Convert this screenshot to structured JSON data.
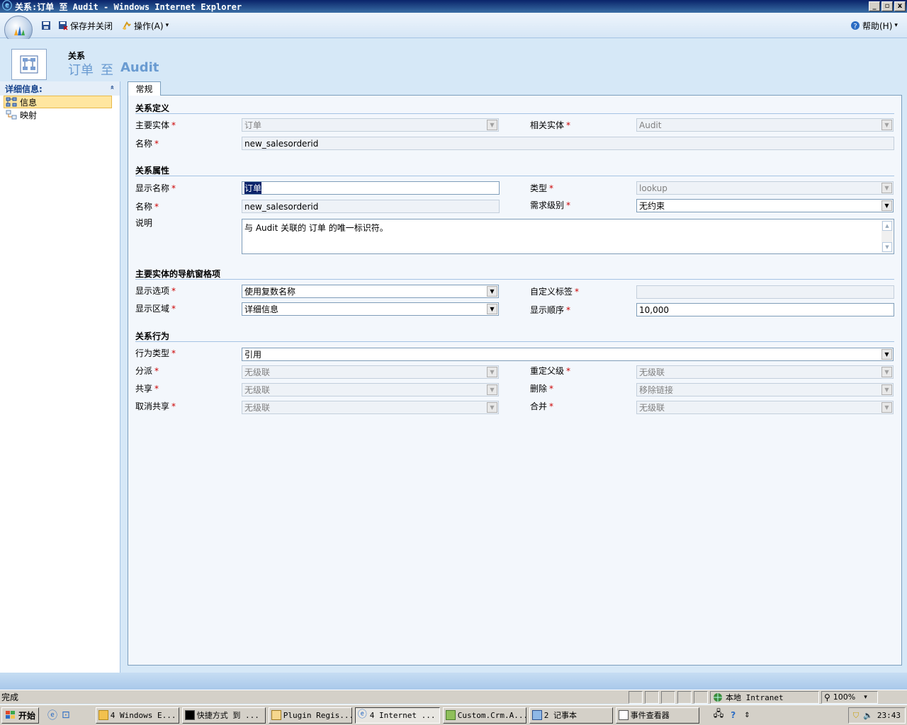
{
  "window": {
    "title": "关系:订单 至 Audit - Windows Internet Explorer",
    "min": "_",
    "restore": "▫",
    "close": "x"
  },
  "toolbar": {
    "save_close_label": "保存并关闭",
    "actions_label": "操作(A)",
    "actions_arrow": "▾",
    "help_label": "帮助(H)",
    "help_arrow": "▾"
  },
  "header": {
    "kind": "关系",
    "title_from": "订单",
    "title_to_word": "至",
    "title_to": "Audit"
  },
  "nav": {
    "section_label": "详细信息:",
    "collapse": "«",
    "items": [
      {
        "label": "信息"
      },
      {
        "label": "映射"
      }
    ]
  },
  "tab": {
    "label": "常规"
  },
  "sections": {
    "definition": "关系定义",
    "attribute": "关系属性",
    "navigation": "主要实体的导航窗格项",
    "behavior": "关系行为"
  },
  "definition": {
    "primary_entity_label": "主要实体",
    "primary_entity_value": "订单",
    "related_entity_label": "相关实体",
    "related_entity_value": "Audit",
    "name_label": "名称",
    "name_value": "new_salesorderid"
  },
  "attribute": {
    "display_name_label": "显示名称",
    "display_name_value": "订单",
    "type_label": "类型",
    "type_value": "lookup",
    "name_label": "名称",
    "name_value": "new_salesorderid",
    "requirement_label": "需求级别",
    "requirement_value": "无约束",
    "description_label": "说明",
    "description_value": "与 Audit 关联的 订单 的唯一标识符。"
  },
  "navigation": {
    "display_option_label": "显示选项",
    "display_option_value": "使用复数名称",
    "custom_label_label": "自定义标签",
    "custom_label_value": "",
    "display_area_label": "显示区域",
    "display_area_value": "详细信息",
    "display_order_label": "显示顺序",
    "display_order_value": "10,000"
  },
  "behavior": {
    "type_label": "行为类型",
    "type_value": "引用",
    "assign_label": "分派",
    "assign_value": "无级联",
    "reparent_label": "重定父级",
    "reparent_value": "无级联",
    "share_label": "共享",
    "share_value": "无级联",
    "delete_label": "删除",
    "delete_value": "移除链接",
    "unshare_label": "取消共享",
    "unshare_value": "无级联",
    "merge_label": "合并",
    "merge_value": "无级联"
  },
  "required_mark": "*",
  "statusbar": {
    "status": "完成",
    "zone": "本地 Intranet",
    "zoom": "100%",
    "zoom_arrow": "▾"
  },
  "taskbar": {
    "start": "开始",
    "buttons": [
      {
        "label": "4 Windows E..."
      },
      {
        "label": "快捷方式 到 ..."
      },
      {
        "label": "Plugin Regis..."
      },
      {
        "label": "4 Internet ..."
      },
      {
        "label": "Custom.Crm.A..."
      },
      {
        "label": "2 记事本"
      },
      {
        "label": "事件查看器"
      }
    ],
    "clock": "23:43"
  },
  "colors": {
    "titlebar": "#0a246a",
    "header_title": "#6a9bd1",
    "required": "#cc0000",
    "nav_selected": "#ffe6a0"
  }
}
